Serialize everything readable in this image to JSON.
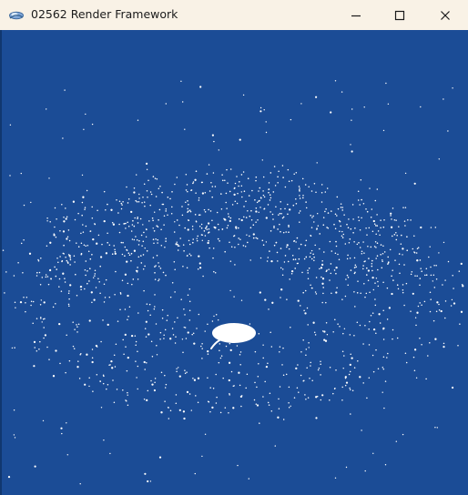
{
  "window": {
    "title": "02562 Render Framework",
    "controls": {
      "minimize": "minimize-icon",
      "maximize": "maximize-icon",
      "close": "close-icon"
    }
  },
  "viewport": {
    "background": "#1b4c96",
    "particle_color": "#ffffff",
    "scene": "particle-swarm-around-white-disc"
  }
}
